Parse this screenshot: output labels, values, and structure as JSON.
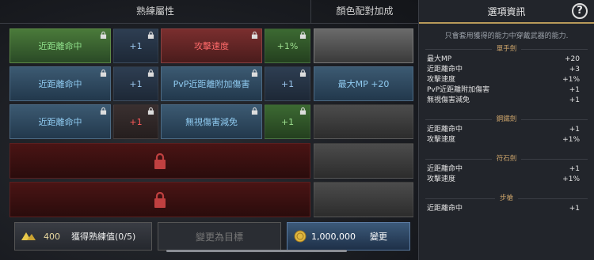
{
  "header": {
    "mastery_label": "熟練屬性",
    "color_label": "顏色配對加成"
  },
  "grid": {
    "row1": {
      "a": "近距離命中",
      "b": "+1",
      "c": "攻擊速度",
      "d": "+1%"
    },
    "row2": {
      "a": "近距離命中",
      "b": "+1",
      "c": "PvP近距離附加傷害",
      "d": "+1",
      "e": "最大MP +20"
    },
    "row3": {
      "a": "近距離命中",
      "b": "+1",
      "c": "無視傷害減免",
      "d": "+1"
    }
  },
  "bottom": {
    "gem_count": "400",
    "mastery_label": "獲得熟練值(0/5)",
    "target_label": "變更為目標",
    "cost": "1,000,000",
    "change_label": "變更"
  },
  "panel": {
    "title": "選項資訊",
    "help": "?",
    "note": "只會套用獲得的能力中穿戴武器的能力.",
    "sections": [
      {
        "title": "單手劍",
        "rows": [
          {
            "k": "最大MP",
            "v": "+20"
          },
          {
            "k": "近距離命中",
            "v": "+3"
          },
          {
            "k": "攻擊速度",
            "v": "+1%"
          },
          {
            "k": "PvP近距離附加傷害",
            "v": "+1"
          },
          {
            "k": "無視傷害減免",
            "v": "+1"
          }
        ]
      },
      {
        "title": "鋼鐵劍",
        "rows": [
          {
            "k": "近距離命中",
            "v": "+1"
          },
          {
            "k": "攻擊速度",
            "v": "+1%"
          }
        ]
      },
      {
        "title": "符石劍",
        "rows": [
          {
            "k": "近距離命中",
            "v": "+1"
          },
          {
            "k": "攻擊速度",
            "v": "+1%"
          }
        ]
      },
      {
        "title": "步槍",
        "rows": [
          {
            "k": "近距離命中",
            "v": "+1"
          }
        ]
      }
    ]
  },
  "colors": {
    "gold": "#c9a26a",
    "green": "#8fe08a",
    "blue": "#8fcaf0",
    "red": "#ff6a6a"
  }
}
